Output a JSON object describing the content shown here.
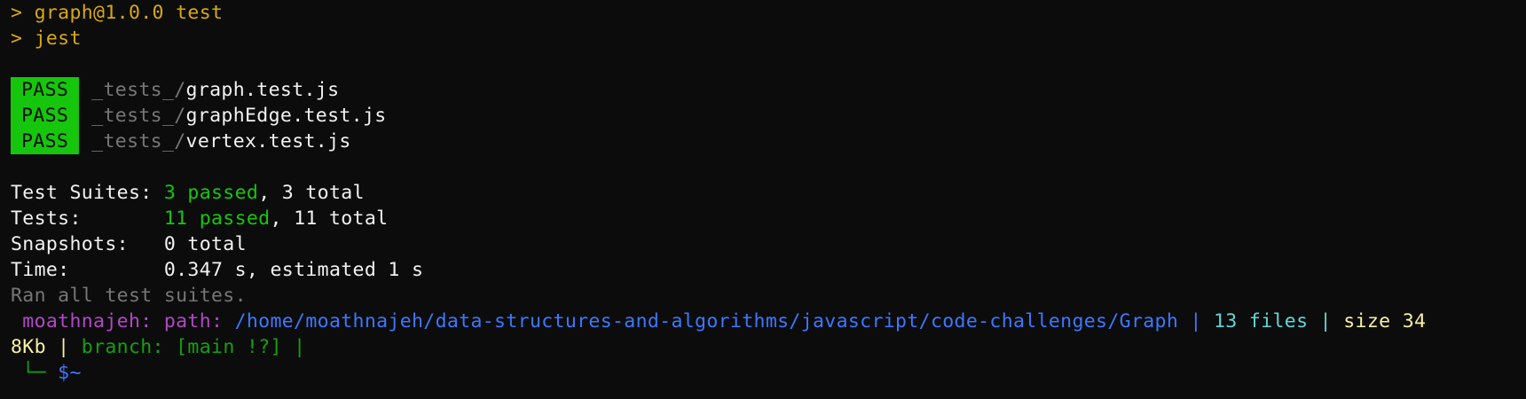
{
  "script_header": {
    "line1": "> graph@1.0.0 test",
    "line2": "> jest"
  },
  "results": [
    {
      "badge": "PASS",
      "dir": "_tests_/",
      "file": "graph.test.js"
    },
    {
      "badge": "PASS",
      "dir": "_tests_/",
      "file": "graphEdge.test.js"
    },
    {
      "badge": "PASS",
      "dir": "_tests_/",
      "file": "vertex.test.js"
    }
  ],
  "summary": {
    "suites_label": "Test Suites: ",
    "suites_passed": "3 passed",
    "suites_total": ", 3 total",
    "tests_label": "Tests:       ",
    "tests_passed": "11 passed",
    "tests_total": ", 11 total",
    "snapshots_label": "Snapshots:   ",
    "snapshots_value": "0 total",
    "time_label": "Time:        ",
    "time_value": "0.347 s, estimated 1 s",
    "ran_all": "Ran all test suites."
  },
  "prompt": {
    "user": " moathnajeh:",
    "path_label": " path:",
    "path": " /home/moathnajeh/data-structures-and-algorithms/javascript/code-challenges/Graph",
    "sep1": " |",
    "files": " 13 files",
    "sep2": " |",
    "size_label": " size 34",
    "size_cont": "8Kb",
    "sep3": " |",
    "branch_label": " branch:",
    "branch_value": " [main !?]",
    "sep4": " |",
    "corner": " └─",
    "cursor": " $~"
  },
  "colors": {
    "background": "#0c0c0c",
    "pass_badge": "#16c60c",
    "header_yellow": "#d8a90e",
    "path_blue": "#3b78ff",
    "user_purple": "#b148c6",
    "info_cyan": "#61d6d6",
    "size_yellow": "#f9f1a5"
  }
}
